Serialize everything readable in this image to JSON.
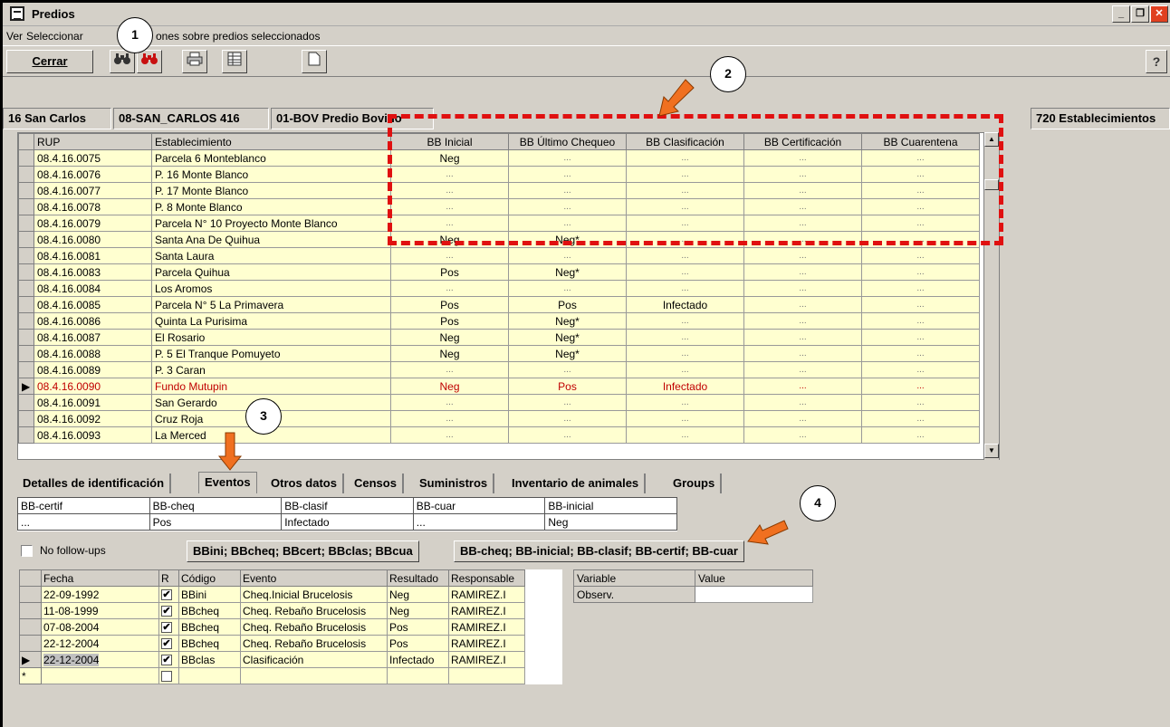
{
  "window": {
    "title": "Predios",
    "buttons": {
      "minimize": "_",
      "restore": "❐",
      "close": "✕"
    }
  },
  "menu": {
    "ver": "Ver",
    "seleccionar": "Seleccionar",
    "acciones": "ones sobre predios seleccionados"
  },
  "toolbar": {
    "cerrar": "Cerrar",
    "help_icon": "?"
  },
  "infobar": {
    "comuna": "16 San Carlos",
    "sector": "08-SAN_CARLOS 416",
    "tipo": "01-BOV Predio Bovino",
    "count": "720 Establecimientos"
  },
  "grid": {
    "columns": [
      "RUP",
      "Establecimiento",
      "BB Inicial",
      "BB Último Chequeo",
      "BB Clasificación",
      "BB Certificación",
      "BB Cuarentena"
    ],
    "rows": [
      [
        "08.4.16.0075",
        "Parcela 6 Monteblanco",
        "Neg",
        "...",
        "...",
        "...",
        "..."
      ],
      [
        "08.4.16.0076",
        "P. 16 Monte Blanco",
        "...",
        "...",
        "...",
        "...",
        "..."
      ],
      [
        "08.4.16.0077",
        "P. 17 Monte Blanco",
        "...",
        "...",
        "...",
        "...",
        "..."
      ],
      [
        "08.4.16.0078",
        "P. 8 Monte Blanco",
        "...",
        "...",
        "...",
        "...",
        "..."
      ],
      [
        "08.4.16.0079",
        "Parcela N° 10 Proyecto Monte Blanco",
        "...",
        "...",
        "...",
        "...",
        "..."
      ],
      [
        "08.4.16.0080",
        "Santa Ana De Quihua",
        "Neg",
        "Neg*",
        "...",
        "...",
        "..."
      ],
      [
        "08.4.16.0081",
        "Santa Laura",
        "...",
        "...",
        "...",
        "...",
        "..."
      ],
      [
        "08.4.16.0083",
        "Parcela Quihua",
        "Pos",
        "Neg*",
        "...",
        "...",
        "..."
      ],
      [
        "08.4.16.0084",
        "Los Aromos",
        "...",
        "...",
        "...",
        "...",
        "..."
      ],
      [
        "08.4.16.0085",
        "Parcela N° 5 La Primavera",
        "Pos",
        "Pos",
        "Infectado",
        "...",
        "..."
      ],
      [
        "08.4.16.0086",
        "Quinta La Purisima",
        "Pos",
        "Neg*",
        "...",
        "...",
        "..."
      ],
      [
        "08.4.16.0087",
        "El Rosario",
        "Neg",
        "Neg*",
        "...",
        "...",
        "..."
      ],
      [
        "08.4.16.0088",
        "P. 5 El Tranque Pomuyeto",
        "Neg",
        "Neg*",
        "...",
        "...",
        "..."
      ],
      [
        "08.4.16.0089",
        "P. 3 Caran",
        "...",
        "...",
        "...",
        "...",
        "..."
      ],
      [
        "08.4.16.0090",
        "Fundo Mutupin",
        "Neg",
        "Pos",
        "Infectado",
        "...",
        "..."
      ],
      [
        "08.4.16.0091",
        "San Gerardo",
        "...",
        "...",
        "...",
        "...",
        "..."
      ],
      [
        "08.4.16.0092",
        "Cruz Roja",
        "...",
        "...",
        "...",
        "...",
        "..."
      ],
      [
        "08.4.16.0093",
        "La Merced",
        "...",
        "...",
        "...",
        "...",
        "..."
      ]
    ],
    "selected_row": 14
  },
  "tabs": [
    "Detalles de identificación",
    "Eventos",
    "Otros datos",
    "Censos",
    "Suministros",
    "Inventario de animales",
    "Groups"
  ],
  "event_summary": {
    "columns": [
      "BB-certif",
      "BB-cheq",
      "BB-clasif",
      "BB-cuar",
      "BB-inicial"
    ],
    "values": [
      "...",
      "Pos",
      "Infectado",
      "...",
      "Neg"
    ]
  },
  "controls": {
    "no_followups": "No follow-ups",
    "btn_order1": "BBini; BBcheq; BBcert; BBclas; BBcua",
    "btn_order2": "BB-cheq; BB-inicial; BB-clasif; BB-certif; BB-cuar"
  },
  "history": {
    "columns": [
      "Fecha",
      "R",
      "Código",
      "Evento",
      "Resultado",
      "Responsable"
    ],
    "rows": [
      [
        "22-09-1992",
        "✔",
        "BBini",
        "Cheq.Inicial Brucelosis",
        "Neg",
        "RAMIREZ.I"
      ],
      [
        "11-08-1999",
        "✔",
        "BBcheq",
        "Cheq. Rebaño Brucelosis",
        "Neg",
        "RAMIREZ.I"
      ],
      [
        "07-08-2004",
        "✔",
        "BBcheq",
        "Cheq. Rebaño Brucelosis",
        "Pos",
        "RAMIREZ.I"
      ],
      [
        "22-12-2004",
        "✔",
        "BBcheq",
        "Cheq. Rebaño Brucelosis",
        "Pos",
        "RAMIREZ.I"
      ],
      [
        "22-12-2004",
        "✔",
        "BBclas",
        "Clasificación",
        "Infectado",
        "RAMIREZ.I"
      ]
    ],
    "new_row_marker": "*"
  },
  "variables": {
    "columns": [
      "Variable",
      "Value"
    ],
    "rows": [
      [
        "Observ.",
        ""
      ]
    ]
  },
  "callouts": [
    "1",
    "2",
    "3",
    "4"
  ],
  "colors": {
    "highlight": "#e01010",
    "arrow": "#f07020",
    "grid_cell": "#ffffd0",
    "selected_text": "#c00000"
  }
}
